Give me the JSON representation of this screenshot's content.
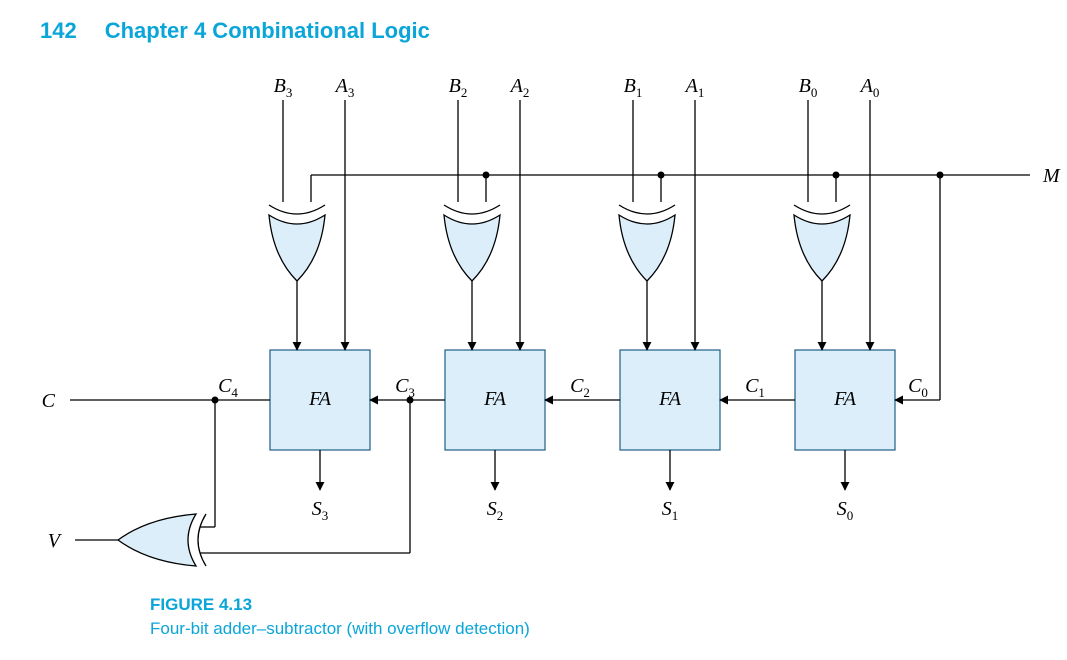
{
  "header": {
    "page_number": "142",
    "chapter_title": "Chapter 4    Combinational Logic"
  },
  "figure": {
    "number": "FIGURE 4.13",
    "title": "Four-bit adder–subtractor (with overflow detection)"
  },
  "diagram": {
    "top_inputs": {
      "B": [
        "B",
        "B",
        "B",
        "B"
      ],
      "B_sub": [
        "3",
        "2",
        "1",
        "0"
      ],
      "A": [
        "A",
        "A",
        "A",
        "A"
      ],
      "A_sub": [
        "3",
        "2",
        "1",
        "0"
      ]
    },
    "fa_label": "FA",
    "carry": {
      "C": "C",
      "C_subs": [
        "4",
        "3",
        "2",
        "1",
        "0"
      ]
    },
    "sum": {
      "S": "S",
      "S_subs": [
        "3",
        "2",
        "1",
        "0"
      ]
    },
    "outputs": {
      "C_out": "C",
      "V": "V",
      "M": "M"
    }
  },
  "chart_data": {
    "type": "diagram",
    "name": "Four-bit adder–subtractor with overflow detection",
    "blocks": [
      {
        "id": "FA3",
        "type": "full-adder",
        "inputs": [
          "A3",
          "B3 XOR M",
          "C3"
        ],
        "outputs": [
          "S3",
          "C4"
        ]
      },
      {
        "id": "FA2",
        "type": "full-adder",
        "inputs": [
          "A2",
          "B2 XOR M",
          "C2"
        ],
        "outputs": [
          "S2",
          "C3"
        ]
      },
      {
        "id": "FA1",
        "type": "full-adder",
        "inputs": [
          "A1",
          "B1 XOR M",
          "C1"
        ],
        "outputs": [
          "S1",
          "C2"
        ]
      },
      {
        "id": "FA0",
        "type": "full-adder",
        "inputs": [
          "A0",
          "B0 XOR M",
          "C0"
        ],
        "outputs": [
          "S0",
          "C1"
        ]
      },
      {
        "id": "XOR_B3",
        "type": "xor",
        "inputs": [
          "B3",
          "M"
        ],
        "output": "B3 XOR M"
      },
      {
        "id": "XOR_B2",
        "type": "xor",
        "inputs": [
          "B2",
          "M"
        ],
        "output": "B2 XOR M"
      },
      {
        "id": "XOR_B1",
        "type": "xor",
        "inputs": [
          "B1",
          "M"
        ],
        "output": "B1 XOR M"
      },
      {
        "id": "XOR_B0",
        "type": "xor",
        "inputs": [
          "B0",
          "M"
        ],
        "output": "B0 XOR M"
      },
      {
        "id": "XOR_V",
        "type": "xor",
        "inputs": [
          "C4",
          "C3"
        ],
        "output": "V"
      }
    ],
    "wires": [
      {
        "from": "M",
        "to": "C0"
      },
      {
        "from": "C4",
        "to": "C"
      }
    ],
    "external_inputs": [
      "A3",
      "A2",
      "A1",
      "A0",
      "B3",
      "B2",
      "B1",
      "B0",
      "M"
    ],
    "external_outputs": [
      "S3",
      "S2",
      "S1",
      "S0",
      "C",
      "V"
    ]
  }
}
